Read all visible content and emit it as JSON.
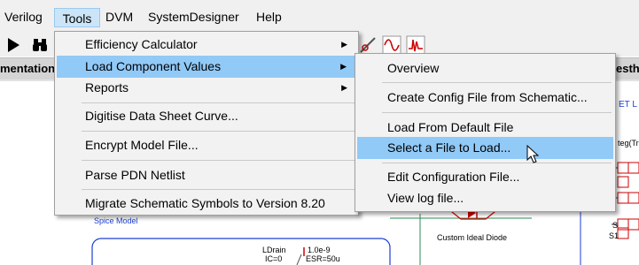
{
  "menubar": {
    "items": [
      {
        "label": "Verilog"
      },
      {
        "label": "Tools"
      },
      {
        "label": "DVM"
      },
      {
        "label": "SystemDesigner"
      },
      {
        "label": "Help"
      }
    ]
  },
  "tabs": {
    "left_label": "mentation",
    "right_label": "esth"
  },
  "tools_menu": {
    "items": [
      {
        "label": "Efficiency Calculator"
      },
      {
        "label": "Load Component Values"
      },
      {
        "label": "Reports"
      },
      {
        "label": "Digitise Data Sheet Curve..."
      },
      {
        "label": "Encrypt Model File..."
      },
      {
        "label": "Parse PDN Netlist"
      },
      {
        "label": "Migrate Schematic Symbols to Version 8.20"
      }
    ]
  },
  "submenu": {
    "items": [
      {
        "label": "Overview"
      },
      {
        "label": "Create Config File from Schematic..."
      },
      {
        "label": "Load From Default File"
      },
      {
        "label": "Select a File to Load..."
      },
      {
        "label": "Edit Configuration File..."
      },
      {
        "label": "View log file..."
      }
    ]
  },
  "schematic": {
    "spice_model_label": "Spice Model",
    "diode_label": "Custom Ideal Diode",
    "ldrain_label": "LDrain",
    "ic_label": "IC=0",
    "cap_value": "1.0e-9",
    "esr_value": "ESR=50u",
    "right_text_top": "ET L",
    "right_text_mid": "teg(Tr",
    "s_label": "S",
    "s1_label": "S1"
  },
  "colors": {
    "highlight": "#91c9f7",
    "menubar_active": "#cce4f7",
    "schematic_blue": "#1a3fd6",
    "schematic_red": "#cc0000",
    "wire_green": "#2e8b57"
  }
}
